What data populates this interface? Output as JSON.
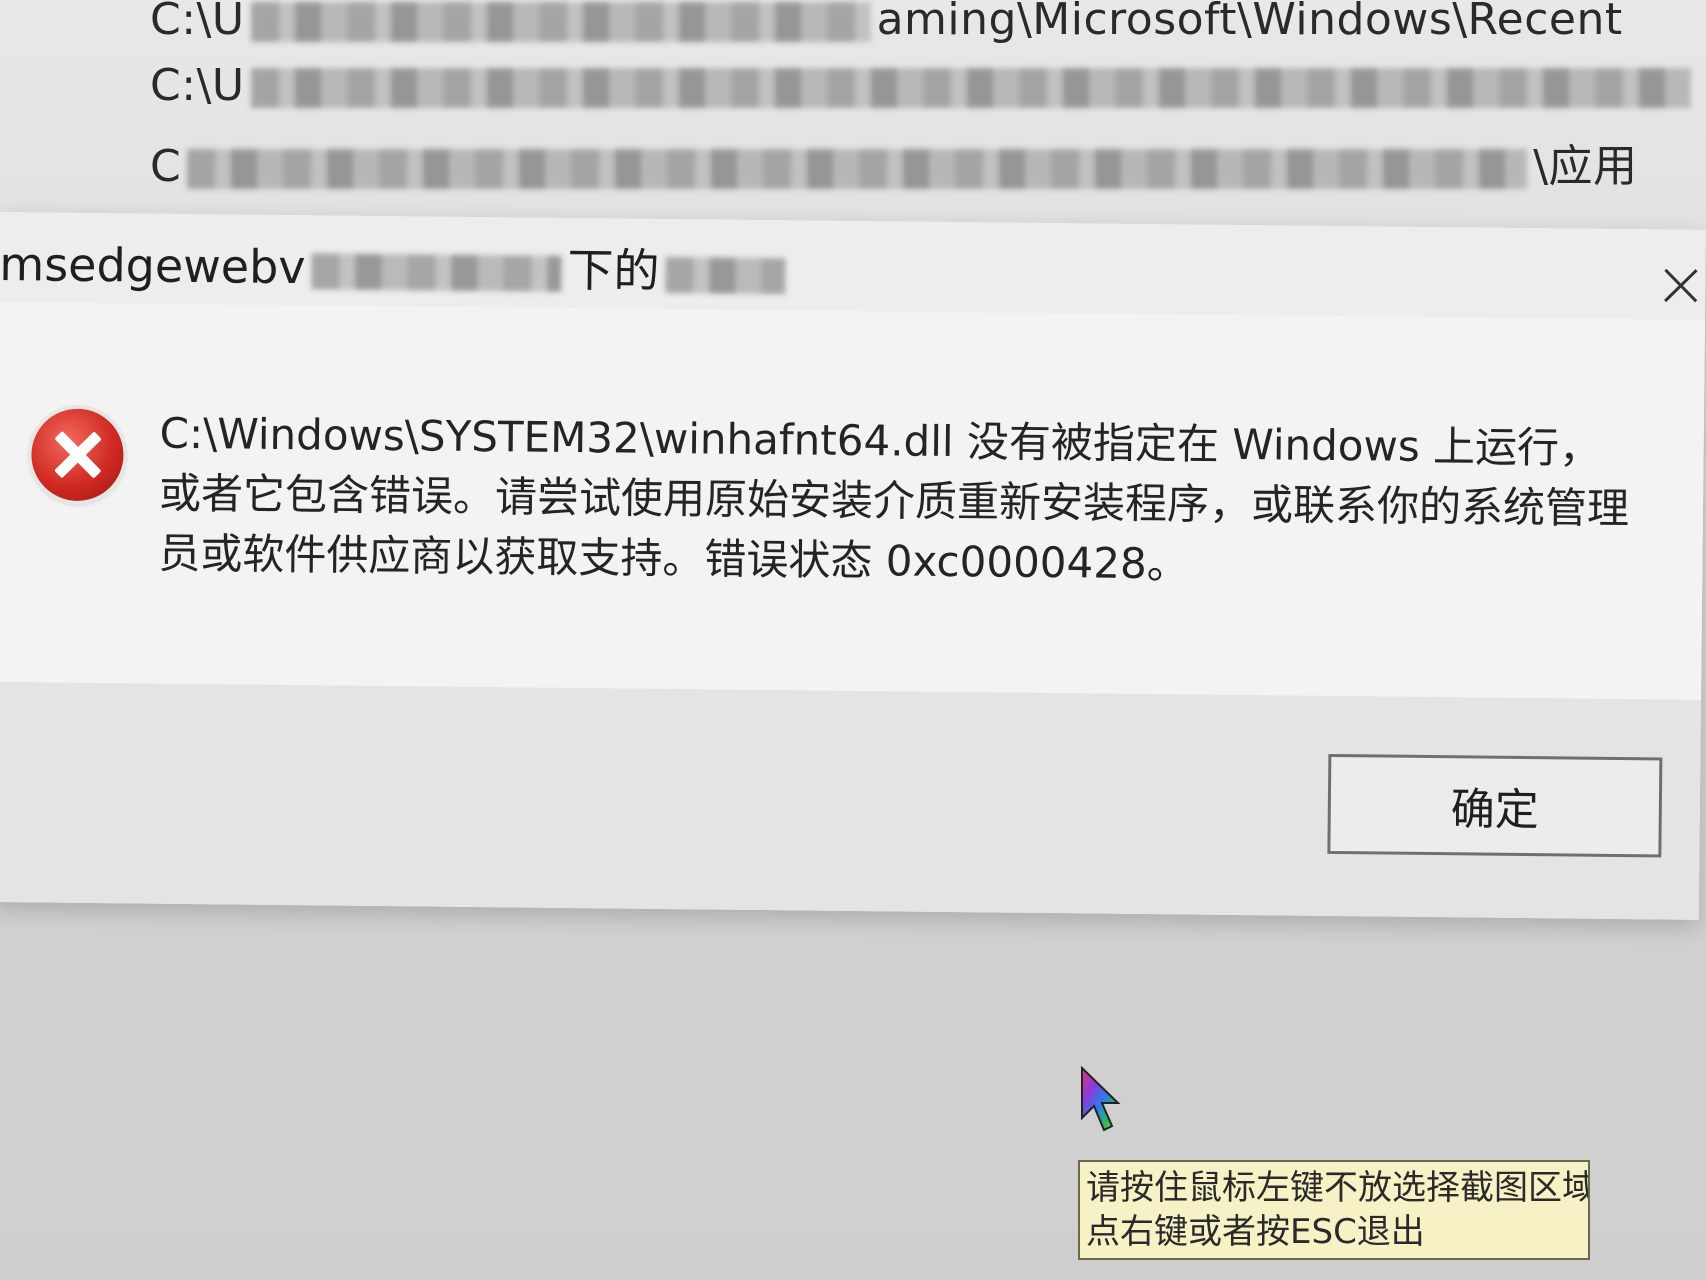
{
  "background_window": {
    "paths": [
      {
        "prefix": "C:\\U",
        "suffix": "aming\\Microsoft\\Windows\\Recent"
      },
      {
        "prefix": "C:\\U",
        "suffix": ""
      },
      {
        "prefix": "C",
        "suffix": "\\应用"
      }
    ]
  },
  "dialog": {
    "title": "msedgewebv",
    "title_suffix": "下的",
    "message": "C:\\Windows\\SYSTEM32\\winhafnt64.dll 没有被指定在 Windows 上运行，或者它包含错误。请尝试使用原始安装介质重新安装程序，或联系你的系统管理员或软件供应商以获取支持。错误状态 0xc0000428。",
    "ok_label": "确定",
    "icon": "error-icon",
    "close_icon": "close-icon"
  },
  "capture_tip": {
    "line1": "请按住鼠标左键不放选择截图区域",
    "line2": "点右键或者按ESC退出"
  },
  "colors": {
    "error_red": "#d12a22",
    "tooltip_bg": "#f7f2c5"
  }
}
